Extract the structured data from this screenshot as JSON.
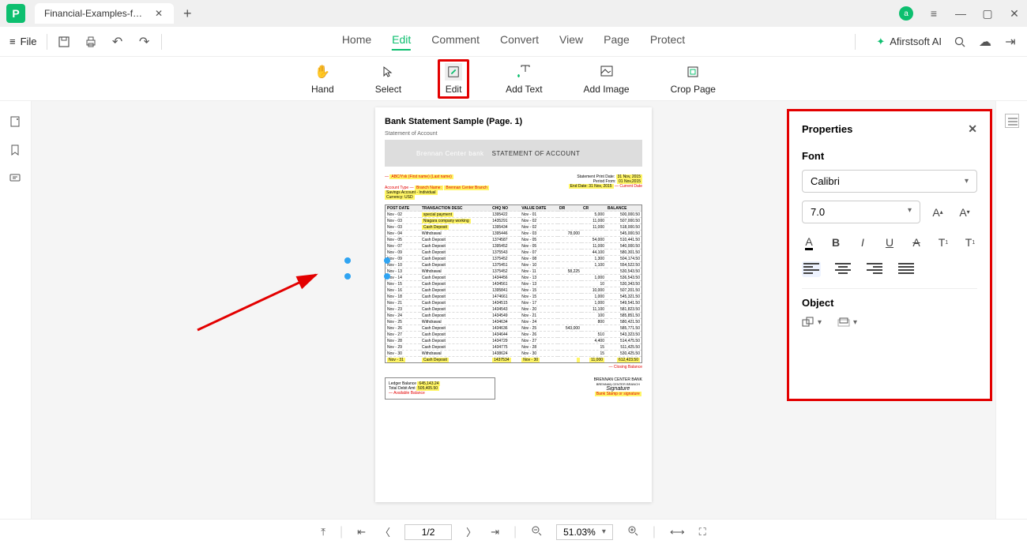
{
  "titlebar": {
    "tab_title": "Financial-Examples-for-I...",
    "avatar_letter": "a"
  },
  "menubar": {
    "file": "File",
    "tabs": [
      "Home",
      "Edit",
      "Comment",
      "Convert",
      "View",
      "Page",
      "Protect"
    ],
    "active_tab_index": 1,
    "ai_label": "Afirstsoft AI"
  },
  "toolbar": {
    "hand": "Hand",
    "select": "Select",
    "edit": "Edit",
    "add_text": "Add Text",
    "add_image": "Add Image",
    "crop_page": "Crop Page"
  },
  "document": {
    "page_title": "Bank Statement Sample (Page. 1)",
    "subtitle": "Statement of Account",
    "banner": "STATEMENT OF ACCOUNT",
    "bank_logo": "Brennan Center bank",
    "annot_address": "ABC/Yxk (First name) (Last name)",
    "annot_account_type": "Account Type",
    "annot_branch": "Branch Name:",
    "annot_branch_val": "Brennan Center Branch",
    "annot_acct_val": "Savings Account - Individual",
    "annot_currency": "Currency: USD",
    "print_date_lbl": "Statement Print Date:",
    "print_date_val": "31 Nov, 2015",
    "period_lbl": "Period From:",
    "period_val": "01 Nov,2015",
    "end_date_lbl": "End Date:",
    "end_date_val": "31 Nov, 2015",
    "current_date": "Current Date",
    "closing_balance": "Closing Balance",
    "available_balance": "Available Balance",
    "footer_bank": "BRENNAN CENTER BANK",
    "footer_branch": "BRENNAN CENTER BRANCH",
    "signature": "Signature",
    "stamp": "Bank Stamp or signature",
    "table_headers": [
      "POST DATE",
      "TRANSACTION DESC",
      "CHQ NO",
      "VALUE DATE",
      "DR",
      "CR",
      "BALANCE"
    ],
    "rows": [
      [
        "Nov - 02",
        "special payment",
        "1395422",
        "Nov - 01",
        "",
        "5,000",
        "500,000.50"
      ],
      [
        "Nov - 03",
        "Niagara company working",
        "1435291",
        "Nov - 02",
        "",
        "11,000",
        "507,000.50"
      ],
      [
        "Nov - 03",
        "Cash Deposit",
        "1395434",
        "Nov - 02",
        "",
        "11,000",
        "518,000.50"
      ],
      [
        "Nov - 04",
        "Withdrawal",
        "1395446",
        "Nov - 03",
        "78,000",
        "",
        "545,000.50"
      ],
      [
        "Nov - 05",
        "Cash Deposit",
        "1374587",
        "Nov - 05",
        "",
        "54,000",
        "510,441.50"
      ],
      [
        "Nov - 07",
        "Cash Deposit",
        "1395452",
        "Nov - 05",
        "",
        "11,000",
        "540,000.50"
      ],
      [
        "Nov - 09",
        "Cash Deposit",
        "1375543",
        "Nov - 07",
        "",
        "44,100",
        "580,301.50"
      ],
      [
        "Nov - 09",
        "Cash Deposit",
        "1375452",
        "Nov - 08",
        "",
        "1,300",
        "504,174.50"
      ],
      [
        "Nov - 10",
        "Cash Deposit",
        "1375451",
        "Nov - 10",
        "",
        "1,100",
        "554,522.50"
      ],
      [
        "Nov - 13",
        "Withdrawal",
        "1375452",
        "Nov - 11",
        "58,225",
        "",
        "530,543.50"
      ],
      [
        "Nov - 14",
        "Cash Deposit",
        "1434456",
        "Nov - 13",
        "",
        "1,000",
        "536,543.50"
      ],
      [
        "Nov - 15",
        "Cash Deposit",
        "1434561",
        "Nov - 13",
        "",
        "10",
        "530,343.50"
      ],
      [
        "Nov - 16",
        "Cash Deposit",
        "1395841",
        "Nov - 15",
        "",
        "10,000",
        "507,201.50"
      ],
      [
        "Nov - 18",
        "Cash Deposit",
        "1474661",
        "Nov - 15",
        "",
        "1,000",
        "545,321.50"
      ],
      [
        "Nov - 21",
        "Cash Deposit",
        "1434515",
        "Nov - 17",
        "",
        "1,000",
        "549,541.50"
      ],
      [
        "Nov - 23",
        "Cash Deposit",
        "1434543",
        "Nov - 20",
        "",
        "11,100",
        "581,823.50"
      ],
      [
        "Nov - 24",
        "Cash Deposit",
        "1434549",
        "Nov - 21",
        "",
        "100",
        "585,851.50"
      ],
      [
        "Nov - 25",
        "Withdrawal",
        "1434634",
        "Nov - 24",
        "",
        "800",
        "580,421.50"
      ],
      [
        "Nov - 26",
        "Cash Deposit",
        "1434636",
        "Nov - 25",
        "543,000",
        "",
        "585,771.50"
      ],
      [
        "Nov - 27",
        "Cash Deposit",
        "1434644",
        "Nov - 26",
        "",
        "510",
        "543,323.50"
      ],
      [
        "Nov - 28",
        "Cash Deposit",
        "1434729",
        "Nov - 27",
        "",
        "4,400",
        "514,475.50"
      ],
      [
        "Nov - 29",
        "Cash Deposit",
        "1434775",
        "Nov - 28",
        "",
        "15",
        "511,425.50"
      ],
      [
        "Nov - 30",
        "Withdrawal",
        "1438624",
        "Nov - 30",
        "",
        "15",
        "530,425.50"
      ],
      [
        "Nov - 31",
        "Cash Deposit",
        "1437534",
        "Nov - 30",
        "",
        "11,000",
        "612,423.50"
      ]
    ]
  },
  "properties": {
    "title": "Properties",
    "font_section": "Font",
    "font_family": "Calibri",
    "font_size": "7.0",
    "object_section": "Object"
  },
  "statusbar": {
    "page": "1/2",
    "zoom": "51.03%"
  }
}
